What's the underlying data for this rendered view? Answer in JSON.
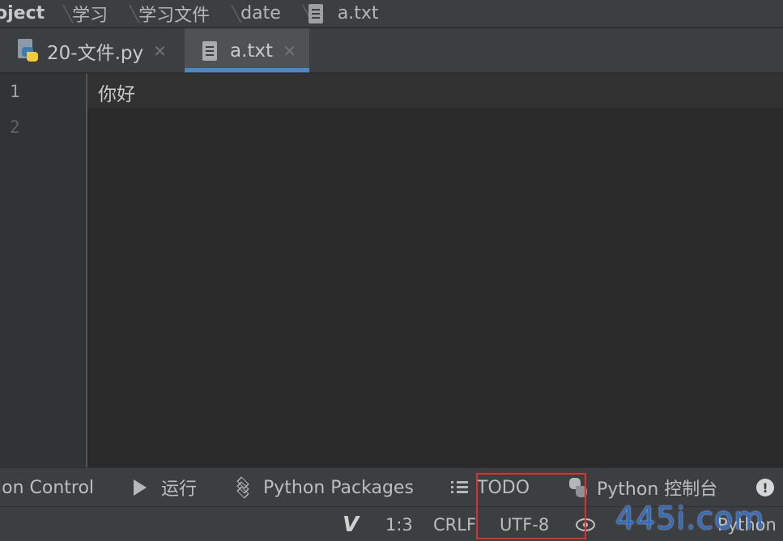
{
  "breadcrumb": {
    "items": [
      "oject",
      "学习",
      "学习文件",
      "date",
      "a.txt"
    ]
  },
  "tabs": [
    {
      "label": "20-文件.py",
      "icon": "python-file-icon",
      "active": false
    },
    {
      "label": "a.txt",
      "icon": "text-file-icon",
      "active": true
    }
  ],
  "editor": {
    "line_numbers": [
      "1",
      "2"
    ],
    "lines": [
      "你好",
      ""
    ]
  },
  "tool_windows": {
    "version_control": "ion Control",
    "run": "运行",
    "python_packages": "Python Packages",
    "todo": "TODO",
    "python_console": "Python 控制台"
  },
  "status": {
    "vcs": "V",
    "position": "1:3",
    "line_separator": "CRLF",
    "encoding": "UTF-8",
    "interpreter": "Python"
  },
  "watermark": "445i.com",
  "colors": {
    "accent": "#4a88c7",
    "highlight_box": "#d9342b",
    "watermark": "#2f6fd0"
  }
}
